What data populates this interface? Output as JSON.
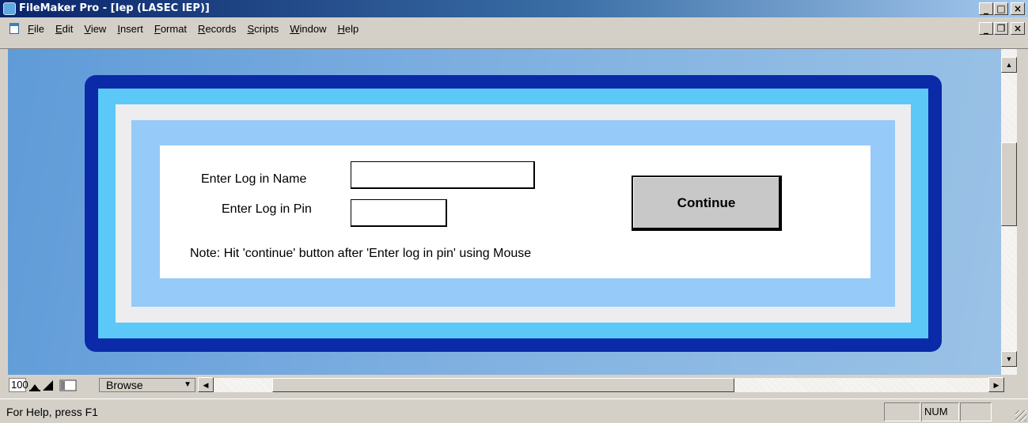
{
  "window": {
    "title": "FileMaker Pro - [Iep (LASEC IEP)]",
    "controls": {
      "minimize": "_",
      "maximize": "□",
      "close": "×"
    }
  },
  "menubar": {
    "items": [
      "File",
      "Edit",
      "View",
      "Insert",
      "Format",
      "Records",
      "Scripts",
      "Window",
      "Help"
    ],
    "mdi_controls": {
      "minimize": "_",
      "restore": "❐",
      "close": "×"
    }
  },
  "login": {
    "name_label": "Enter Log in Name",
    "name_value": "",
    "pin_label": "Enter Log in Pin",
    "pin_value": "",
    "note": "Note: Hit 'continue' button after 'Enter log in pin' using Mouse",
    "continue_label": "Continue"
  },
  "bottombar": {
    "zoom": "100",
    "mode": "Browse"
  },
  "statusbar": {
    "help_text": "For Help, press F1",
    "num_indicator": "NUM"
  },
  "colors": {
    "frame_dark": "#0a2aa8",
    "frame_cyan": "#5bc8f8",
    "frame_light": "#96caf8",
    "canvas_blue": "#74a8de"
  }
}
